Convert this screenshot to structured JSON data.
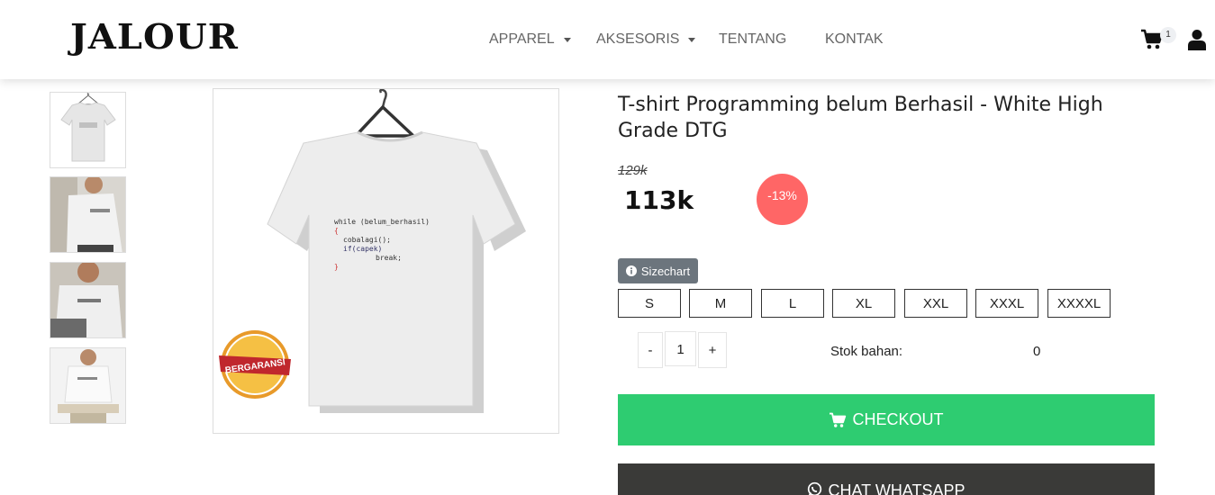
{
  "header": {
    "logo": "JALOUR",
    "nav": [
      {
        "label": "APPAREL",
        "has_dropdown": true
      },
      {
        "label": "AKSESORIS",
        "has_dropdown": true
      },
      {
        "label": "TENTANG",
        "has_dropdown": false
      },
      {
        "label": "KONTAK",
        "has_dropdown": false
      }
    ],
    "cart_count": "1",
    "cart_icon": "shopping-cart-icon",
    "user_icon": "user-icon"
  },
  "gallery": {
    "thumbnails": [
      "thumbnail-1",
      "thumbnail-2",
      "thumbnail-3",
      "thumbnail-4"
    ],
    "main_image_badge": "BERGARANSI",
    "shirt_code": [
      "while (belum_berhasil)",
      "{",
      "cobalagi();",
      "if(capek)",
      "break;",
      "}"
    ]
  },
  "product": {
    "title": "T-shirt Programming belum Berhasil - White High Grade DTG",
    "old_price": "129k",
    "price": "113k",
    "discount": "-13%",
    "sizechart_label": "Sizechart",
    "sizes": [
      "S",
      "M",
      "L",
      "XL",
      "XXL",
      "XXXL",
      "XXXXL"
    ],
    "qty_minus": "-",
    "qty_value": "1",
    "qty_plus": "+",
    "stock_label": "Stok bahan:",
    "stock_value": "0",
    "checkout_label": "CHECKOUT",
    "whatsapp_label": "CHAT WHATSAPP"
  },
  "colors": {
    "checkout": "#2ecc71",
    "whatsapp": "#3a3a38",
    "discount": "#ff6666",
    "sizechart": "#6c757d"
  }
}
